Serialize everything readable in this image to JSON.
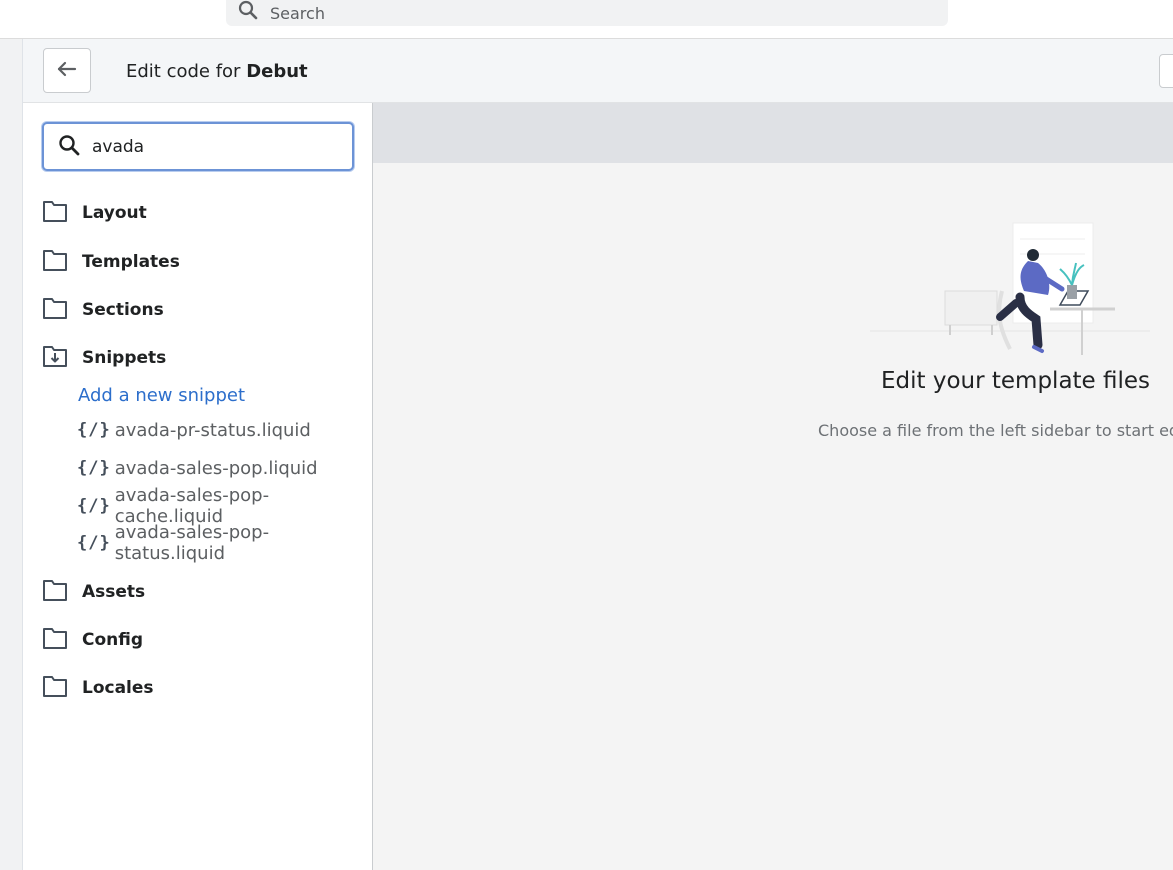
{
  "topbar": {
    "search_placeholder": "Search"
  },
  "header": {
    "title_prefix": "Edit code for",
    "theme_name": "Debut"
  },
  "sidebar": {
    "search_value": "avada",
    "folders": {
      "layout": "Layout",
      "templates": "Templates",
      "sections": "Sections",
      "snippets": "Snippets",
      "assets": "Assets",
      "config": "Config",
      "locales": "Locales"
    },
    "add_snippet_label": "Add a new snippet",
    "code_glyph": "{/}",
    "snippets": [
      "avada-pr-status.liquid",
      "avada-sales-pop.liquid",
      "avada-sales-pop-cache.liquid",
      "avada-sales-pop-status.liquid"
    ]
  },
  "main": {
    "empty_title": "Edit your template files",
    "empty_subtitle": "Choose a file from the left sidebar to start edit"
  },
  "colors": {
    "link": "#2c6ecb",
    "focus_ring": "#6c93d6",
    "tabbar": "#dfe1e5",
    "illustration_accent": "#5c6ac4"
  }
}
